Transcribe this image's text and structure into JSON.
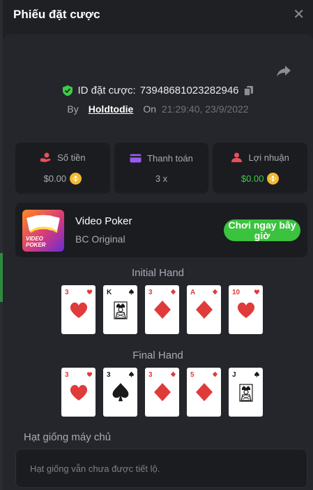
{
  "header": {
    "title": "Phiếu đặt cược",
    "close_icon": "close-icon"
  },
  "bet": {
    "id_label": "ID đặt cược:",
    "id_value": "73948681023282946",
    "by_label": "By",
    "username": "Holdtodie",
    "on_label": "On",
    "timestamp": "21:29:40, 23/9/2022"
  },
  "stats": [
    {
      "label": "Số tiền",
      "value": "$0.00",
      "icon": "bet-amount-icon",
      "color": "#e8505b"
    },
    {
      "label": "Thanh toán",
      "value": "3 x",
      "icon": "payout-card-icon",
      "color": "#9b59f5"
    },
    {
      "label": "Lợi nhuận",
      "value": "$0.00",
      "icon": "profit-icon",
      "color": "#e8505b"
    }
  ],
  "game": {
    "name": "Video Poker",
    "provider": "BC Original",
    "thumb_label_1": "VIDEO",
    "thumb_label_2": "POKER",
    "play_label_1": "Chơi ngay bây",
    "play_label_2": "giờ"
  },
  "initial_hand": {
    "title": "Initial Hand",
    "cards": [
      {
        "rank": "3",
        "suit": "hearts"
      },
      {
        "rank": "K",
        "suit": "spades"
      },
      {
        "rank": "3",
        "suit": "diamonds"
      },
      {
        "rank": "A",
        "suit": "diamonds"
      },
      {
        "rank": "10",
        "suit": "hearts"
      }
    ]
  },
  "final_hand": {
    "title": "Final Hand",
    "cards": [
      {
        "rank": "3",
        "suit": "hearts"
      },
      {
        "rank": "3",
        "suit": "spades"
      },
      {
        "rank": "3",
        "suit": "diamonds"
      },
      {
        "rank": "5",
        "suit": "diamonds"
      },
      {
        "rank": "J",
        "suit": "spades"
      }
    ]
  },
  "seed": {
    "title": "Hạt giống máy chủ",
    "message": "Hạt giống vẫn chưa được tiết lộ."
  },
  "colors": {
    "accent_green": "#3bc23f",
    "coin": "#f3ba2f",
    "shield": "#3dcc45"
  }
}
